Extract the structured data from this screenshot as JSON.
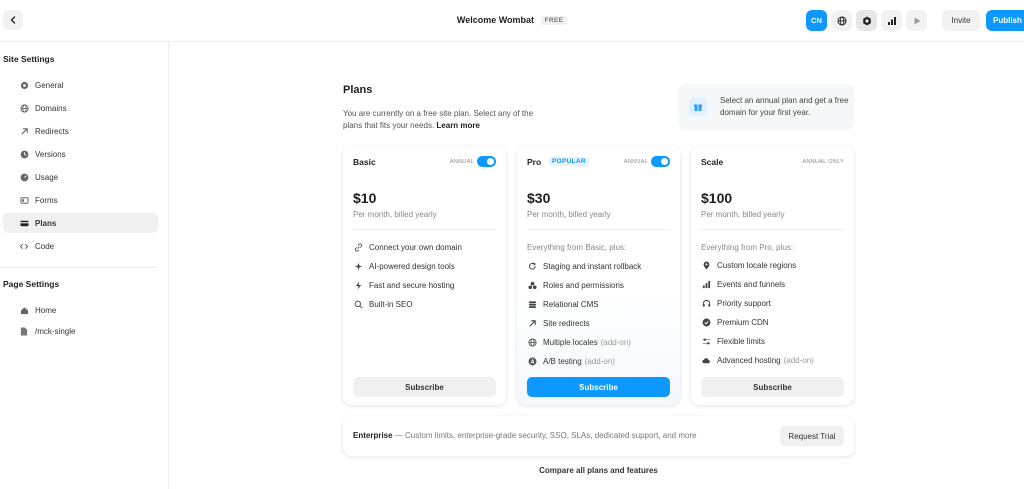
{
  "header": {
    "title": "Welcome Wombat",
    "badge": "FREE",
    "locale_button": "CN",
    "invite_label": "Invite",
    "publish_label": "Publish"
  },
  "sidebar": {
    "site_heading": "Site Settings",
    "site_items": [
      {
        "label": "General",
        "icon": "gear-icon"
      },
      {
        "label": "Domains",
        "icon": "globe-icon"
      },
      {
        "label": "Redirects",
        "icon": "arrow-up-right-icon"
      },
      {
        "label": "Versions",
        "icon": "clock-icon"
      },
      {
        "label": "Usage",
        "icon": "gauge-icon"
      },
      {
        "label": "Forms",
        "icon": "form-icon"
      },
      {
        "label": "Plans",
        "icon": "card-icon",
        "active": true
      },
      {
        "label": "Code",
        "icon": "code-icon"
      }
    ],
    "page_heading": "Page Settings",
    "page_items": [
      {
        "label": "Home",
        "icon": "home-icon"
      },
      {
        "label": "/mck-single",
        "icon": "page-icon"
      }
    ]
  },
  "plans": {
    "title": "Plans",
    "description": "You are currently on a free site plan. Select any of the plans that fits your needs.",
    "learn_more": "Learn more",
    "promo_text": "Select an annual plan and get a free domain for your first year.",
    "cards": [
      {
        "name": "Basic",
        "annual_label": "ANNUAL",
        "price": "$10",
        "billing": "Per month, billed yearly",
        "from": "",
        "features": [
          {
            "text": "Connect your own domain",
            "icon": "link-icon",
            "addon": ""
          },
          {
            "text": "AI-powered design tools",
            "icon": "sparkle-icon",
            "addon": ""
          },
          {
            "text": "Fast and secure hosting",
            "icon": "bolt-icon",
            "addon": ""
          },
          {
            "text": "Built-in SEO",
            "icon": "search-icon",
            "addon": ""
          }
        ],
        "button": "Subscribe"
      },
      {
        "name": "Pro",
        "badge": "POPULAR",
        "annual_label": "ANNUAL",
        "price": "$30",
        "billing": "Per month, billed yearly",
        "from": "Everything from Basic, plus:",
        "features": [
          {
            "text": "Staging and instant rollback",
            "icon": "refresh-icon",
            "addon": ""
          },
          {
            "text": "Roles and permissions",
            "icon": "users-icon",
            "addon": ""
          },
          {
            "text": "Relational CMS",
            "icon": "database-icon",
            "addon": ""
          },
          {
            "text": "Site redirects",
            "icon": "arrow-up-right-icon",
            "addon": ""
          },
          {
            "text": "Multiple locales",
            "icon": "globe-icon",
            "addon": "(add-on)"
          },
          {
            "text": "A/B testing",
            "icon": "ab-icon",
            "addon": "(add-on)"
          }
        ],
        "button": "Subscribe"
      },
      {
        "name": "Scale",
        "annual_label": "ANNUAL ONLY",
        "price": "$100",
        "billing": "Per month, billed yearly",
        "from": "Everything from Pro, plus:",
        "features": [
          {
            "text": "Custom locale regions",
            "icon": "pin-icon",
            "addon": ""
          },
          {
            "text": "Events and funnels",
            "icon": "chart-icon",
            "addon": ""
          },
          {
            "text": "Priority support",
            "icon": "headset-icon",
            "addon": ""
          },
          {
            "text": "Premium CDN",
            "icon": "check-circle-icon",
            "addon": ""
          },
          {
            "text": "Flexible limits",
            "icon": "sliders-icon",
            "addon": ""
          },
          {
            "text": "Advanced hosting",
            "icon": "cloud-icon",
            "addon": "(add-on)"
          }
        ],
        "button": "Subscribe"
      }
    ],
    "enterprise": {
      "name": "Enterprise",
      "text": " — Custom limits, enterprise-grade security, SSO, SLAs, dedicated support, and more",
      "button": "Request Trial"
    },
    "compare_link": "Compare all plans and features"
  },
  "colors": {
    "accent": "#0d99ff"
  }
}
